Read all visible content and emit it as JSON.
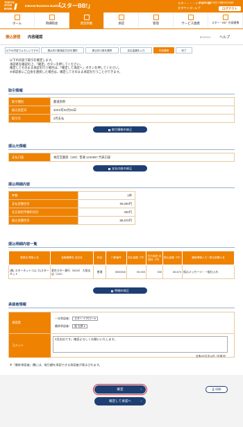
{
  "header": {
    "logo_lines": [
      "TOKYO",
      "STAR",
      "BANK"
    ],
    "service": "Internet Business Banking",
    "brand": "「スターBB!」",
    "user": "スター・・・イチロー 様",
    "timestamp": "2000年02月13日 10時00分00秒",
    "font_size": "文字サイズ",
    "help": "ヘルプ",
    "logout": "ログアウト"
  },
  "nav": [
    {
      "label": "ホーム"
    },
    {
      "label": "明細照会"
    },
    {
      "label": "資金移動"
    },
    {
      "label": "承認"
    },
    {
      "label": "管理"
    },
    {
      "label": "サービス連携"
    },
    {
      "label": "スター・BB！外部連携"
    }
  ],
  "page": {
    "title": "振込振替",
    "subtitle": "内容確認",
    "id": "BFKF024",
    "help": "ヘルプ"
  },
  "steps": [
    "以下の内容でよろしいですか",
    "振込先口座指定方法を選択",
    "振込先口座を選択",
    "支払金額を入力",
    "内容確認",
    "完了"
  ],
  "instructions": [
    "以下の内容で取引を確定します。",
    "承認者を確認の上、「確定」ボタンを押してください。",
    "確定してそのまま承認を行う場合は、「確定して承認へ」ボタンを押してください。",
    "※承認者にご自身を選択した場合は、確定してそのまま承認を行うことができます。"
  ],
  "transaction": {
    "heading": "取引情報",
    "rows": [
      {
        "k": "取引種別",
        "v": "都道府県"
      },
      {
        "k": "振込指定日",
        "v": "20XX年02月02日"
      },
      {
        "k": "取引名",
        "v": "2月支払"
      }
    ],
    "button": "取引情報の修正"
  },
  "source": {
    "heading": "振込元情報",
    "rows": [
      {
        "k": "支払口座",
        "v": "本店営業部（100）普通 1234567 代表口座"
      }
    ],
    "button": "支払口座の修正"
  },
  "summary": {
    "heading": "振込明細内容",
    "rows": [
      {
        "k": "件数",
        "v": "1件"
      },
      {
        "k": "支払金額合計",
        "v": "90,000円"
      },
      {
        "k": "先方負担手数料合計",
        "v": "330円"
      },
      {
        "k": "振込金額合計",
        "v": "89,670円"
      }
    ]
  },
  "details": {
    "heading": "振込明細内容一覧",
    "headers": [
      "登録名 受取人名",
      "金融機関名 支店名",
      "科目",
      "口座番号",
      "支払金額（円）",
      "先方負担 手数料（円）",
      "振込金額（円）",
      "顧客情報入力 / 振込依頼人名"
    ],
    "rows": [
      {
        "c1": "(株) スターネットコム カ)スターネット",
        "c2": "東京スター銀行（0526） 大阪支店（220）",
        "c3": "普通",
        "c4": "0000000",
        "c5": "90,000",
        "c6": "330",
        "c7": "89,670",
        "c8": "振込メッセージ：一般仕入れ"
      }
    ],
    "button": "明細の修正"
  },
  "approver": {
    "heading": "承認者情報",
    "k1": "承認者",
    "first_label": "一次承認者：",
    "first_value": "スター イチロー",
    "final_label": "最終承認者：",
    "final_value": "星 太郎",
    "k2": "コメント",
    "comment": "2月支払です。確認よろしくお願いいたします。",
    "counter": "全角120文字以内［半角可］",
    "footnote": "※「最終承認者」欄には、取引額を承認できる承認者が表示されます。"
  },
  "footer": {
    "confirm": "確定",
    "confirm_approve": "確定して承認へ",
    "print": "印刷"
  },
  "colors": {
    "brand": "#ef8200",
    "navy": "#1e3f73",
    "highlight": "#d9232e"
  }
}
